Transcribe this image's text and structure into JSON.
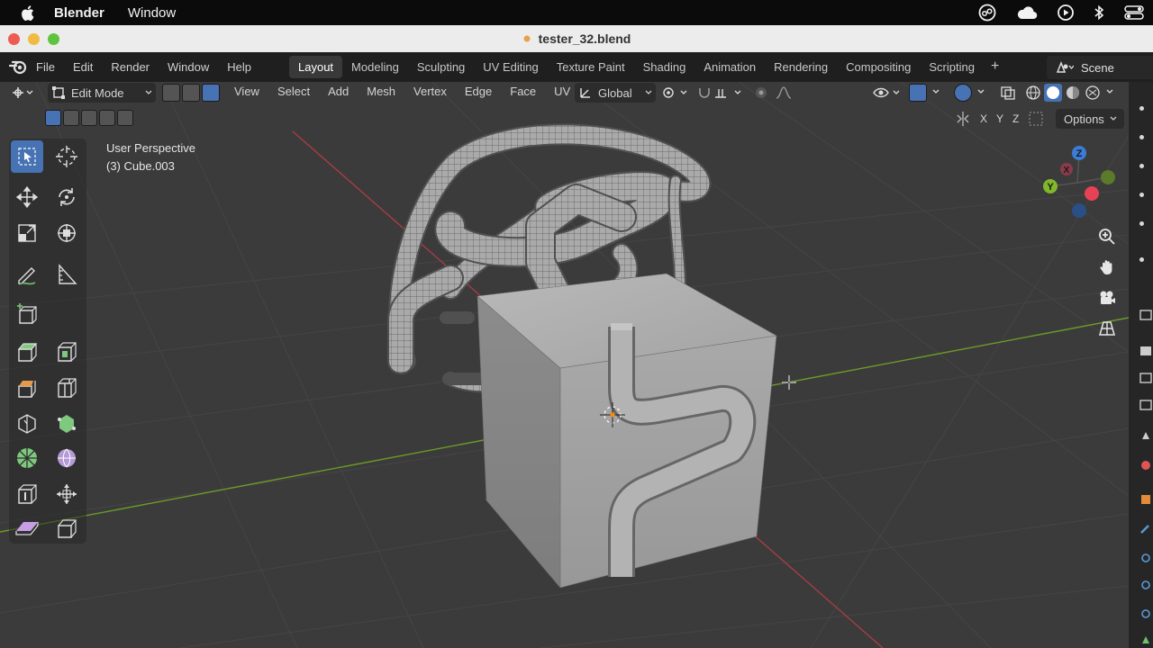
{
  "macbar": {
    "app_name": "Blender",
    "menu": [
      "Window"
    ],
    "icons": [
      "apple-icon",
      "creative-cloud-icon",
      "icloud-icon",
      "play-icon",
      "bluetooth-icon",
      "control-center-icon"
    ]
  },
  "window": {
    "title": "tester_32.blend"
  },
  "topbar": {
    "menu": [
      "File",
      "Edit",
      "Render",
      "Window",
      "Help"
    ],
    "tabs": [
      "Layout",
      "Modeling",
      "Sculpting",
      "UV Editing",
      "Texture Paint",
      "Shading",
      "Animation",
      "Rendering",
      "Compositing",
      "Scripting"
    ],
    "active_tab": "Layout",
    "add_tab": "+",
    "scene_label": "Scene"
  },
  "viewport_header": {
    "mode": "Edit Mode",
    "menus": [
      "View",
      "Select",
      "Add",
      "Mesh",
      "Vertex",
      "Edge",
      "Face",
      "UV"
    ],
    "orientation": "Global",
    "axes": [
      "X",
      "Y",
      "Z"
    ],
    "options_label": "Options"
  },
  "overlay": {
    "perspective": "User Perspective",
    "object": "(3) Cube.003"
  },
  "gizmo": {
    "x_label": "X",
    "y_label": "Y",
    "z_label": "Z",
    "colors": {
      "x": "#e64155",
      "y": "#7fb82a",
      "z": "#3b7cd8"
    }
  },
  "colors": {
    "accent": "#4772b3",
    "viewport_bg": "#3b3b3b",
    "grid_line": "#454545",
    "x_axis": "#a83d45",
    "y_axis": "#6c9a27"
  }
}
